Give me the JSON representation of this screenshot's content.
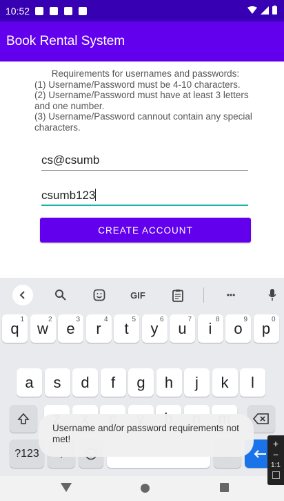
{
  "status_bar": {
    "time": "10:52"
  },
  "app_bar": {
    "title": "Book Rental System"
  },
  "requirements": {
    "heading": "Requirements for usernames and passwords:",
    "rule1": "(1) Username/Password must be 4-10 characters.",
    "rule2": "(2) Username/Password must have at least 3 letters and one number.",
    "rule3": "(3) Username/Password cannout contain any special characters."
  },
  "form": {
    "username_value": "cs@csumb",
    "password_value": "csumb123",
    "create_button_label": "CREATE ACCOUNT"
  },
  "keyboard": {
    "toolbar": {
      "gif_label": "GIF",
      "more_label": "•••"
    },
    "row1": [
      {
        "key": "q",
        "hint": "1"
      },
      {
        "key": "w",
        "hint": "2"
      },
      {
        "key": "e",
        "hint": "3"
      },
      {
        "key": "r",
        "hint": "4"
      },
      {
        "key": "t",
        "hint": "5"
      },
      {
        "key": "y",
        "hint": "6"
      },
      {
        "key": "u",
        "hint": "7"
      },
      {
        "key": "i",
        "hint": "8"
      },
      {
        "key": "o",
        "hint": "9"
      },
      {
        "key": "p",
        "hint": "0"
      }
    ],
    "row2": [
      "a",
      "s",
      "d",
      "f",
      "g",
      "h",
      "j",
      "k",
      "l"
    ],
    "row3": [
      "z",
      "x",
      "c",
      "v",
      "b",
      "n",
      "m"
    ],
    "symbols_label": "?123",
    "comma_label": ",",
    "period_label": "."
  },
  "toast": {
    "message": "Username and/or password requirements not met!"
  },
  "side_panel": {
    "plus_label": "+",
    "minus_label": "–",
    "ratio_label": "1:1"
  }
}
